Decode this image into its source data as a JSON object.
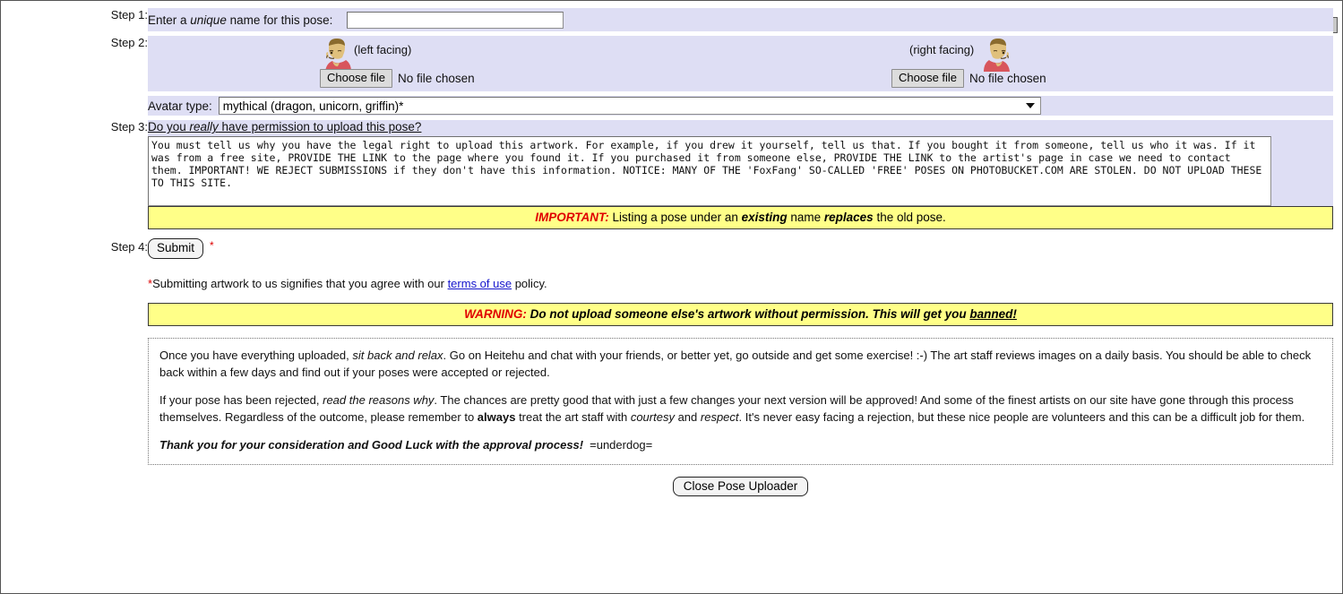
{
  "window": {
    "close_icon": "close-x-icon"
  },
  "steps": {
    "step1": {
      "label": "Step 1:",
      "prompt_before": "Enter a ",
      "prompt_em": "unique",
      "prompt_after": " name for this pose:",
      "input_value": "",
      "input_placeholder": ""
    },
    "step2": {
      "label": "Step 2:",
      "left_facing_label": "(left facing)",
      "right_facing_label": "(right facing)",
      "choose_file_label": "Choose file",
      "no_file_label": "No file chosen",
      "avatar_type_label": "Avatar type:",
      "avatar_type_selected": "mythical (dragon, unicorn, griffin)*"
    },
    "step3": {
      "label": "Step 3:",
      "question_before": "Do you ",
      "question_em": "really",
      "question_after": " have permission to upload this pose?",
      "textarea_value": "You must tell us why you have the legal right to upload this artwork. For example, if you drew it yourself, tell us that. If you bought it from someone, tell us who it was. If it was from a free site, PROVIDE THE LINK to the page where you found it. If you purchased it from someone else, PROVIDE THE LINK to the artist's page in case we need to contact them. IMPORTANT! WE REJECT SUBMISSIONS if they don't have this information. NOTICE: MANY OF THE 'FoxFang' SO-CALLED 'FREE' POSES ON PHOTOBUCKET.COM ARE STOLEN. DO NOT UPLOAD THESE TO THIS SITE."
    },
    "step4": {
      "label": "Step 4:",
      "submit_label": "Submit",
      "required_star": "*",
      "tos_star": "*",
      "tos_before": "Submitting artwork to us signifies that you agree with our ",
      "tos_link": "terms of use",
      "tos_after": " policy."
    }
  },
  "banners": {
    "important": {
      "lead": "IMPORTANT:",
      "part1": " Listing a pose under an ",
      "em1": "existing",
      "part2": " name ",
      "em2": "replaces",
      "part3": " the old pose."
    },
    "warning": {
      "lead": "WARNING:",
      "body_before": " Do not upload someone else's artwork without permission. This will get you ",
      "body_link": "banned!"
    }
  },
  "info": {
    "p1_a": "Once you have everything uploaded, ",
    "p1_em": "sit back and relax",
    "p1_b": ". Go on Heitehu and chat with your friends, or better yet, go outside and get some exercise! :-) The art staff reviews images on a daily basis. You should be able to check back within a few days and find out if your poses were accepted or rejected.",
    "p2_a": "If your pose has been rejected, ",
    "p2_em": "read the reasons why",
    "p2_b": ". The chances are pretty good that with just a few changes your next version will be approved! And some of the finest artists on our site have gone through this process themselves. Regardless of the outcome, please remember to ",
    "p2_bold": "always",
    "p2_c": " treat the art staff with ",
    "p2_em2": "courtesy",
    "p2_d": " and ",
    "p2_em3": "respect",
    "p2_e": ". It's never easy facing a rejection, but these nice people are volunteers and this can be a difficult job for them.",
    "p3_thanks": "Thank you for your consideration and Good Luck with the approval process!",
    "p3_sig": "=underdog="
  },
  "footer": {
    "close_label": "Close Pose Uploader"
  },
  "colors": {
    "panel": "#dedef4",
    "banner": "#ffff88",
    "alert_red": "#e00000",
    "link_blue": "#1414cc"
  }
}
